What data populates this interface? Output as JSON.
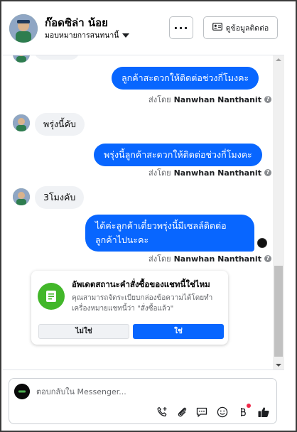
{
  "header": {
    "contact_name": "ก๊อดซิล่า น้อย",
    "assign_label": "มอบหมายการสนทนานี้",
    "info_button_label": "ดูข้อมูลติดต่อ",
    "more_button_label": "···"
  },
  "messages": [
    {
      "direction": "out",
      "text": "ลูกค้าสะดวกให้ติดต่อช่วงกี่โมงคะ",
      "sent_by_prefix": "ส่งโดย",
      "sent_by_name": "Nanwhan Nanthanit"
    },
    {
      "direction": "in",
      "text": "พรุ่งนี้คับ"
    },
    {
      "direction": "out",
      "text": "พรุ่งนี้ลูกค้าสะดวกให้ติดต่อช่วงกี่โมงคะ",
      "sent_by_prefix": "ส่งโดย",
      "sent_by_name": "Nanwhan Nanthanit"
    },
    {
      "direction": "in",
      "text": "3โมงคับ"
    },
    {
      "direction": "out",
      "text": "ได้ค่ะลูกค้าเดี๋ยวพรุ่งนี้มีเซลล์ติดต่อลูกค้าไปนะคะ",
      "sent_by_prefix": "ส่งโดย",
      "sent_by_name": "Nanwhan Nanthanit"
    }
  ],
  "order_card": {
    "title": "อัพเดตสถานะคำสั่งซื้อของแชทนี้ใช่ไหม",
    "body": "คุณสามารถจัดระเบียบกล่องข้อความได้โดยทำเครื่องหมายแชทนี้ว่า \"สั่งซื้อแล้ว\"",
    "no_label": "ไม่ใช่",
    "yes_label": "ใช่"
  },
  "composer": {
    "placeholder": "ตอบกลับใน Messenger..."
  },
  "colors": {
    "accent_blue": "#0866ff",
    "incoming_bubble": "#f0f2f5",
    "card_icon_green": "#42b72a",
    "notification_red": "#f02849"
  }
}
